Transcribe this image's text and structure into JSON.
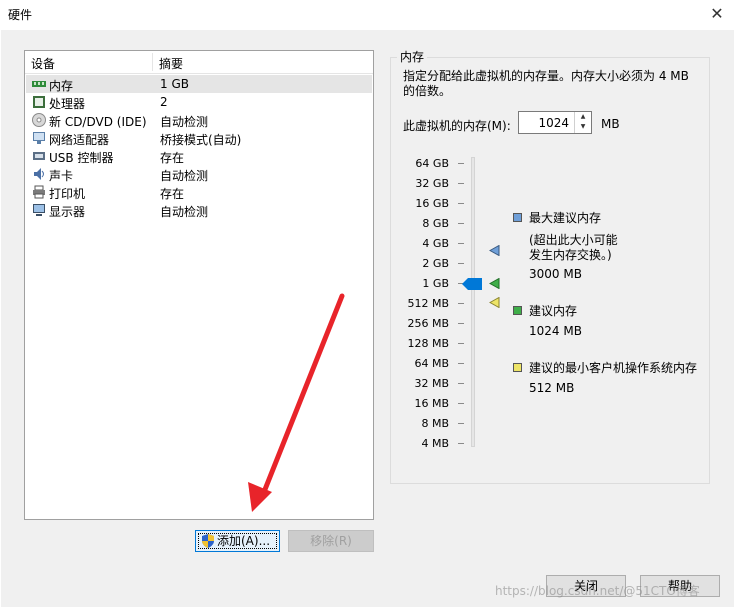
{
  "window": {
    "title": "硬件",
    "close_glyph": "✕"
  },
  "device_list": {
    "columns": {
      "device": "设备",
      "summary": "摘要"
    },
    "rows": [
      {
        "name": "内存",
        "summary": "1 GB",
        "icon": "memory-icon",
        "selected": true
      },
      {
        "name": "处理器",
        "summary": "2",
        "icon": "processor-icon"
      },
      {
        "name": "新 CD/DVD (IDE)",
        "summary": "自动检测",
        "icon": "cd-dvd-icon"
      },
      {
        "name": "网络适配器",
        "summary": "桥接模式(自动)",
        "icon": "network-adapter-icon"
      },
      {
        "name": "USB 控制器",
        "summary": "存在",
        "icon": "usb-icon"
      },
      {
        "name": "声卡",
        "summary": "自动检测",
        "icon": "sound-card-icon"
      },
      {
        "name": "打印机",
        "summary": "存在",
        "icon": "printer-icon"
      },
      {
        "name": "显示器",
        "summary": "自动检测",
        "icon": "display-icon"
      }
    ]
  },
  "buttons": {
    "add_label": "添加(A)...",
    "remove_label": "移除(R)",
    "ok_label": "关闭",
    "help_label": "帮助"
  },
  "memory": {
    "group_title": "内存",
    "description": "指定分配给此虚拟机的内存量。内存大小必须为 4 MB 的倍数。",
    "field_label": "此虚拟机的内存(M):",
    "value": "1024",
    "unit": "MB",
    "scale": [
      "64 GB",
      "32 GB",
      "16 GB",
      "8 GB",
      "4 GB",
      "2 GB",
      "1 GB",
      "512 MB",
      "256 MB",
      "128 MB",
      "64 MB",
      "32 MB",
      "16 MB",
      "8 MB",
      "4 MB"
    ],
    "legend": {
      "max_title": "最大建议内存",
      "max_note_1": "(超出此大小可能",
      "max_note_2": "发生内存交换。)",
      "max_value": "3000 MB",
      "rec_title": "建议内存",
      "rec_value": "1024 MB",
      "min_title": "建议的最小客户机操作系统内存",
      "min_value": "512 MB"
    }
  },
  "watermark": "https://blog.csdn.net/@51CTO博客",
  "colors": {
    "accent": "#0078d7",
    "max_marker": "#6f9fd8",
    "rec_marker": "#3fae49",
    "min_marker": "#ede467",
    "arrow": "#e8242a"
  }
}
